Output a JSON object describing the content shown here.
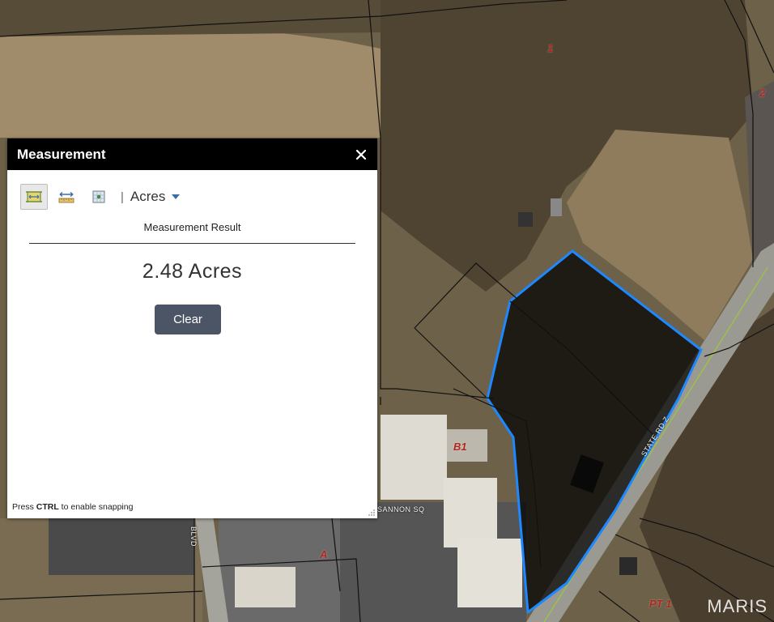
{
  "widget": {
    "title": "Measurement",
    "tools": [
      {
        "name": "area-tool-icon",
        "active": true
      },
      {
        "name": "distance-tool-icon",
        "active": false
      },
      {
        "name": "location-tool-icon",
        "active": false
      }
    ],
    "separator": "|",
    "unit": "Acres",
    "result_label": "Measurement Result",
    "result_value": "2.48 Acres",
    "clear_label": "Clear",
    "hint_prefix": "Press ",
    "hint_key": "CTRL",
    "hint_suffix": " to enable snapping"
  },
  "map": {
    "parcel_labels": [
      "1",
      "2",
      "B1",
      "A",
      "PT 1"
    ],
    "street_labels": [
      "STATE RD Z",
      "SANNON SQ",
      "BLVD"
    ],
    "watermark": "MARIS",
    "colors": {
      "measure_outline": "#1e88ff",
      "parcel_lines": "#111111",
      "parcel_label": "#b3261e"
    }
  }
}
